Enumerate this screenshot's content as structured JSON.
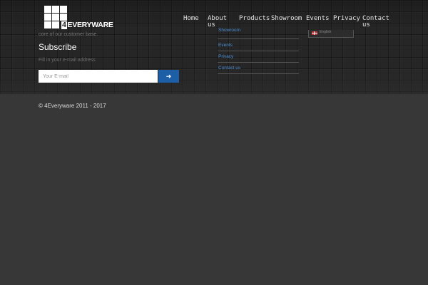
{
  "header": {
    "logo": {
      "number": "4",
      "text": "EVERYWARE"
    },
    "nav": [
      {
        "label": "Home"
      },
      {
        "label": "About us"
      },
      {
        "label": "Products"
      },
      {
        "label": "Showroom"
      },
      {
        "label": "Events"
      },
      {
        "label": "Privacy"
      },
      {
        "label": "Contact us"
      }
    ]
  },
  "footer": {
    "about_text_fragment": "core of our customer base.",
    "subscribe": {
      "title": "Subscribe",
      "hint": "Fill in your e-mail address",
      "email_placeholder": "Your E-mail",
      "submit_icon": "arrow-right-icon",
      "submit_glyph": "➜",
      "accent_color": "#1d5fa6"
    },
    "links": [
      {
        "label": "Showroom"
      },
      {
        "label": "Events"
      },
      {
        "label": "Privacy"
      },
      {
        "label": "Contact us"
      }
    ],
    "language": {
      "label": "English",
      "icon": "uk-flag-icon"
    },
    "copyright": "© 4Everyware 2011 - 2017"
  }
}
